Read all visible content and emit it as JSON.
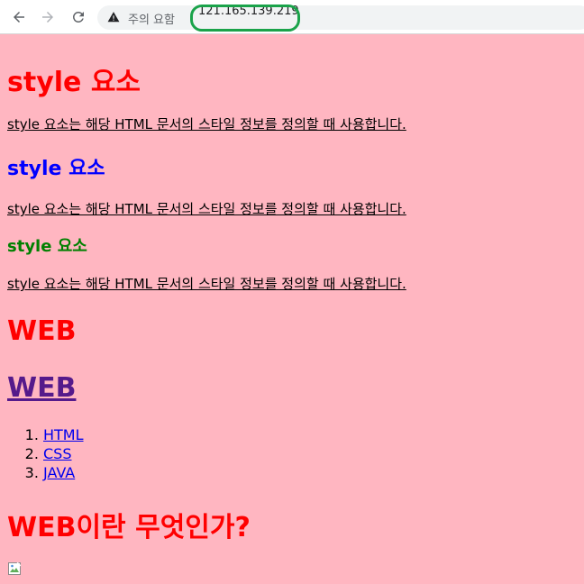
{
  "browser": {
    "security_warning": "주의 요함",
    "url": "121.165.139.219",
    "highlight_color": "#1aa34a"
  },
  "page": {
    "background": "#ffb6c1",
    "headings": {
      "style_red": "style 요소",
      "style_blue": "style 요소",
      "style_green": "style 요소",
      "web_red": "WEB",
      "web_link": "WEB",
      "question": "WEB이란 무엇인가?"
    },
    "paragraphs": [
      "style 요소는 해당 HTML 문서의 스타일 정보를 정의할 때 사용합니다.",
      "style 요소는 해당 HTML 문서의 스타일 정보를 정의할 때 사용합니다.",
      "style 요소는 해당 HTML 문서의 스타일 정보를 정의할 때 사용합니다."
    ],
    "list_items": [
      "HTML",
      "CSS",
      "JAVA"
    ],
    "colors": {
      "red": "#ff0000",
      "blue": "#0000ff",
      "green": "#008000",
      "visited_link": "#551a8b",
      "link": "#0000ee"
    },
    "image_icon": "broken-image-icon"
  }
}
